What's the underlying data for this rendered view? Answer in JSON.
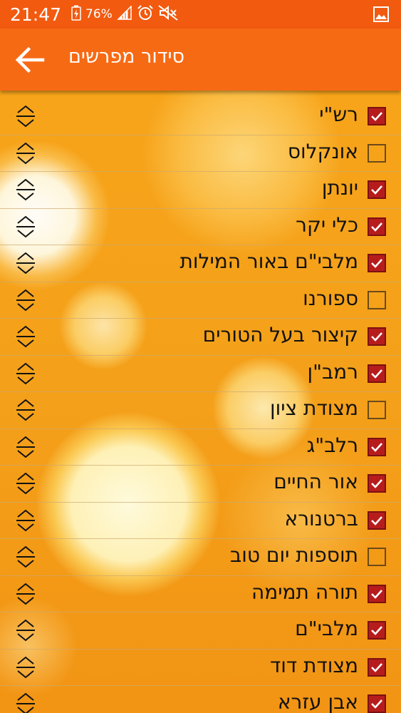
{
  "status_bar": {
    "time": "21:47",
    "battery": "76%",
    "icons": [
      "charging-battery-icon",
      "signal-icon",
      "alarm-icon",
      "mute-icon",
      "gallery-icon"
    ]
  },
  "app_bar": {
    "title": "סידור מפרשים",
    "back_icon": "arrow-back-icon"
  },
  "colors": {
    "status_bar": "#f25a0f",
    "app_bar": "#f76a14",
    "checkbox_checked": "#b71c1c"
  },
  "items": [
    {
      "label": "רש\"י",
      "checked": true
    },
    {
      "label": "אונקלוס",
      "checked": false
    },
    {
      "label": "יונתן",
      "checked": true
    },
    {
      "label": "כלי יקר",
      "checked": true
    },
    {
      "label": "מלבי\"ם באור המילות",
      "checked": true
    },
    {
      "label": "ספורנו",
      "checked": false
    },
    {
      "label": "קיצור בעל הטורים",
      "checked": true
    },
    {
      "label": "רמב\"ן",
      "checked": true
    },
    {
      "label": "מצודת ציון",
      "checked": false
    },
    {
      "label": "רלב\"ג",
      "checked": true
    },
    {
      "label": "אור החיים",
      "checked": true
    },
    {
      "label": "ברטנורא",
      "checked": true
    },
    {
      "label": "תוספות יום טוב",
      "checked": false
    },
    {
      "label": "תורה תמימה",
      "checked": true
    },
    {
      "label": "מלבי\"ם",
      "checked": true
    },
    {
      "label": "מצודת דוד",
      "checked": true
    },
    {
      "label": "אבן עזרא",
      "checked": true
    }
  ]
}
